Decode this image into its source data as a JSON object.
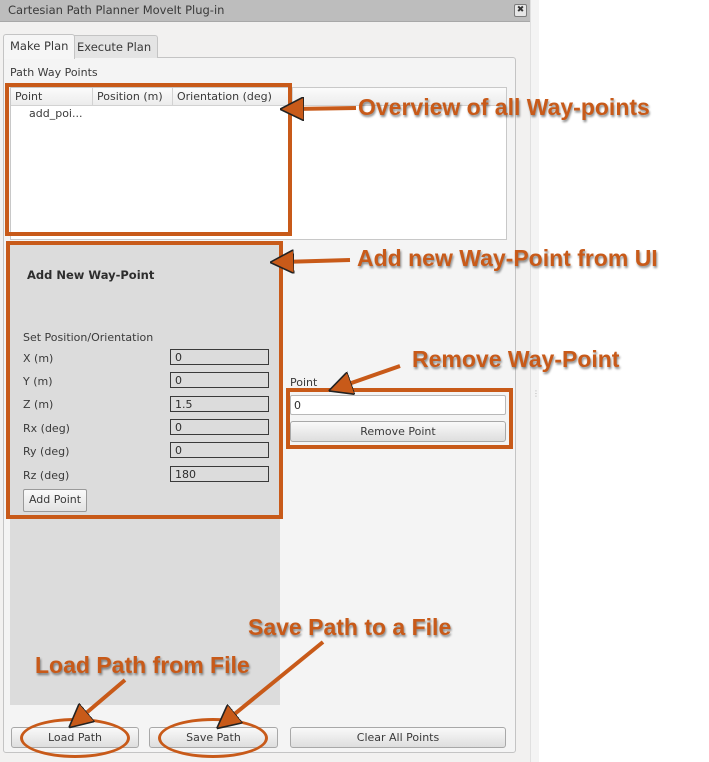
{
  "window": {
    "title": "Cartesian Path Planner MoveIt Plug-in",
    "close_icon": "close-icon"
  },
  "tabs": [
    {
      "label": "Make Plan",
      "active": true
    },
    {
      "label": "Execute Plan",
      "active": false
    }
  ],
  "waypoints": {
    "section_label": "Path Way Points",
    "columns": [
      "Point",
      "Position (m)",
      "Orientation (deg)"
    ],
    "rows": [
      {
        "point": "add_poi...",
        "position": "",
        "orientation": ""
      }
    ]
  },
  "add_point": {
    "title": "Add New Way-Point",
    "set_label": "Set Position/Orientation",
    "fields": [
      {
        "label": "X (m)",
        "value": "0"
      },
      {
        "label": "Y (m)",
        "value": "0"
      },
      {
        "label": "Z (m)",
        "value": "1.5"
      },
      {
        "label": "Rx (deg)",
        "value": "0"
      },
      {
        "label": "Ry (deg)",
        "value": "0"
      },
      {
        "label": "Rz (deg)",
        "value": "180"
      }
    ],
    "button_label": "Add Point"
  },
  "remove_point": {
    "label": "Point",
    "value": "0",
    "button_label": "Remove Point"
  },
  "bottom_buttons": {
    "load": "Load Path",
    "save": "Save Path",
    "clear": "Clear All Points"
  },
  "annotations": {
    "color": "#c85a19",
    "overview": "Overview of all Way-points",
    "add": "Add new Way-Point from UI",
    "remove": "Remove Way-Point",
    "save": "Save Path to a File",
    "load": "Load Path from File"
  }
}
